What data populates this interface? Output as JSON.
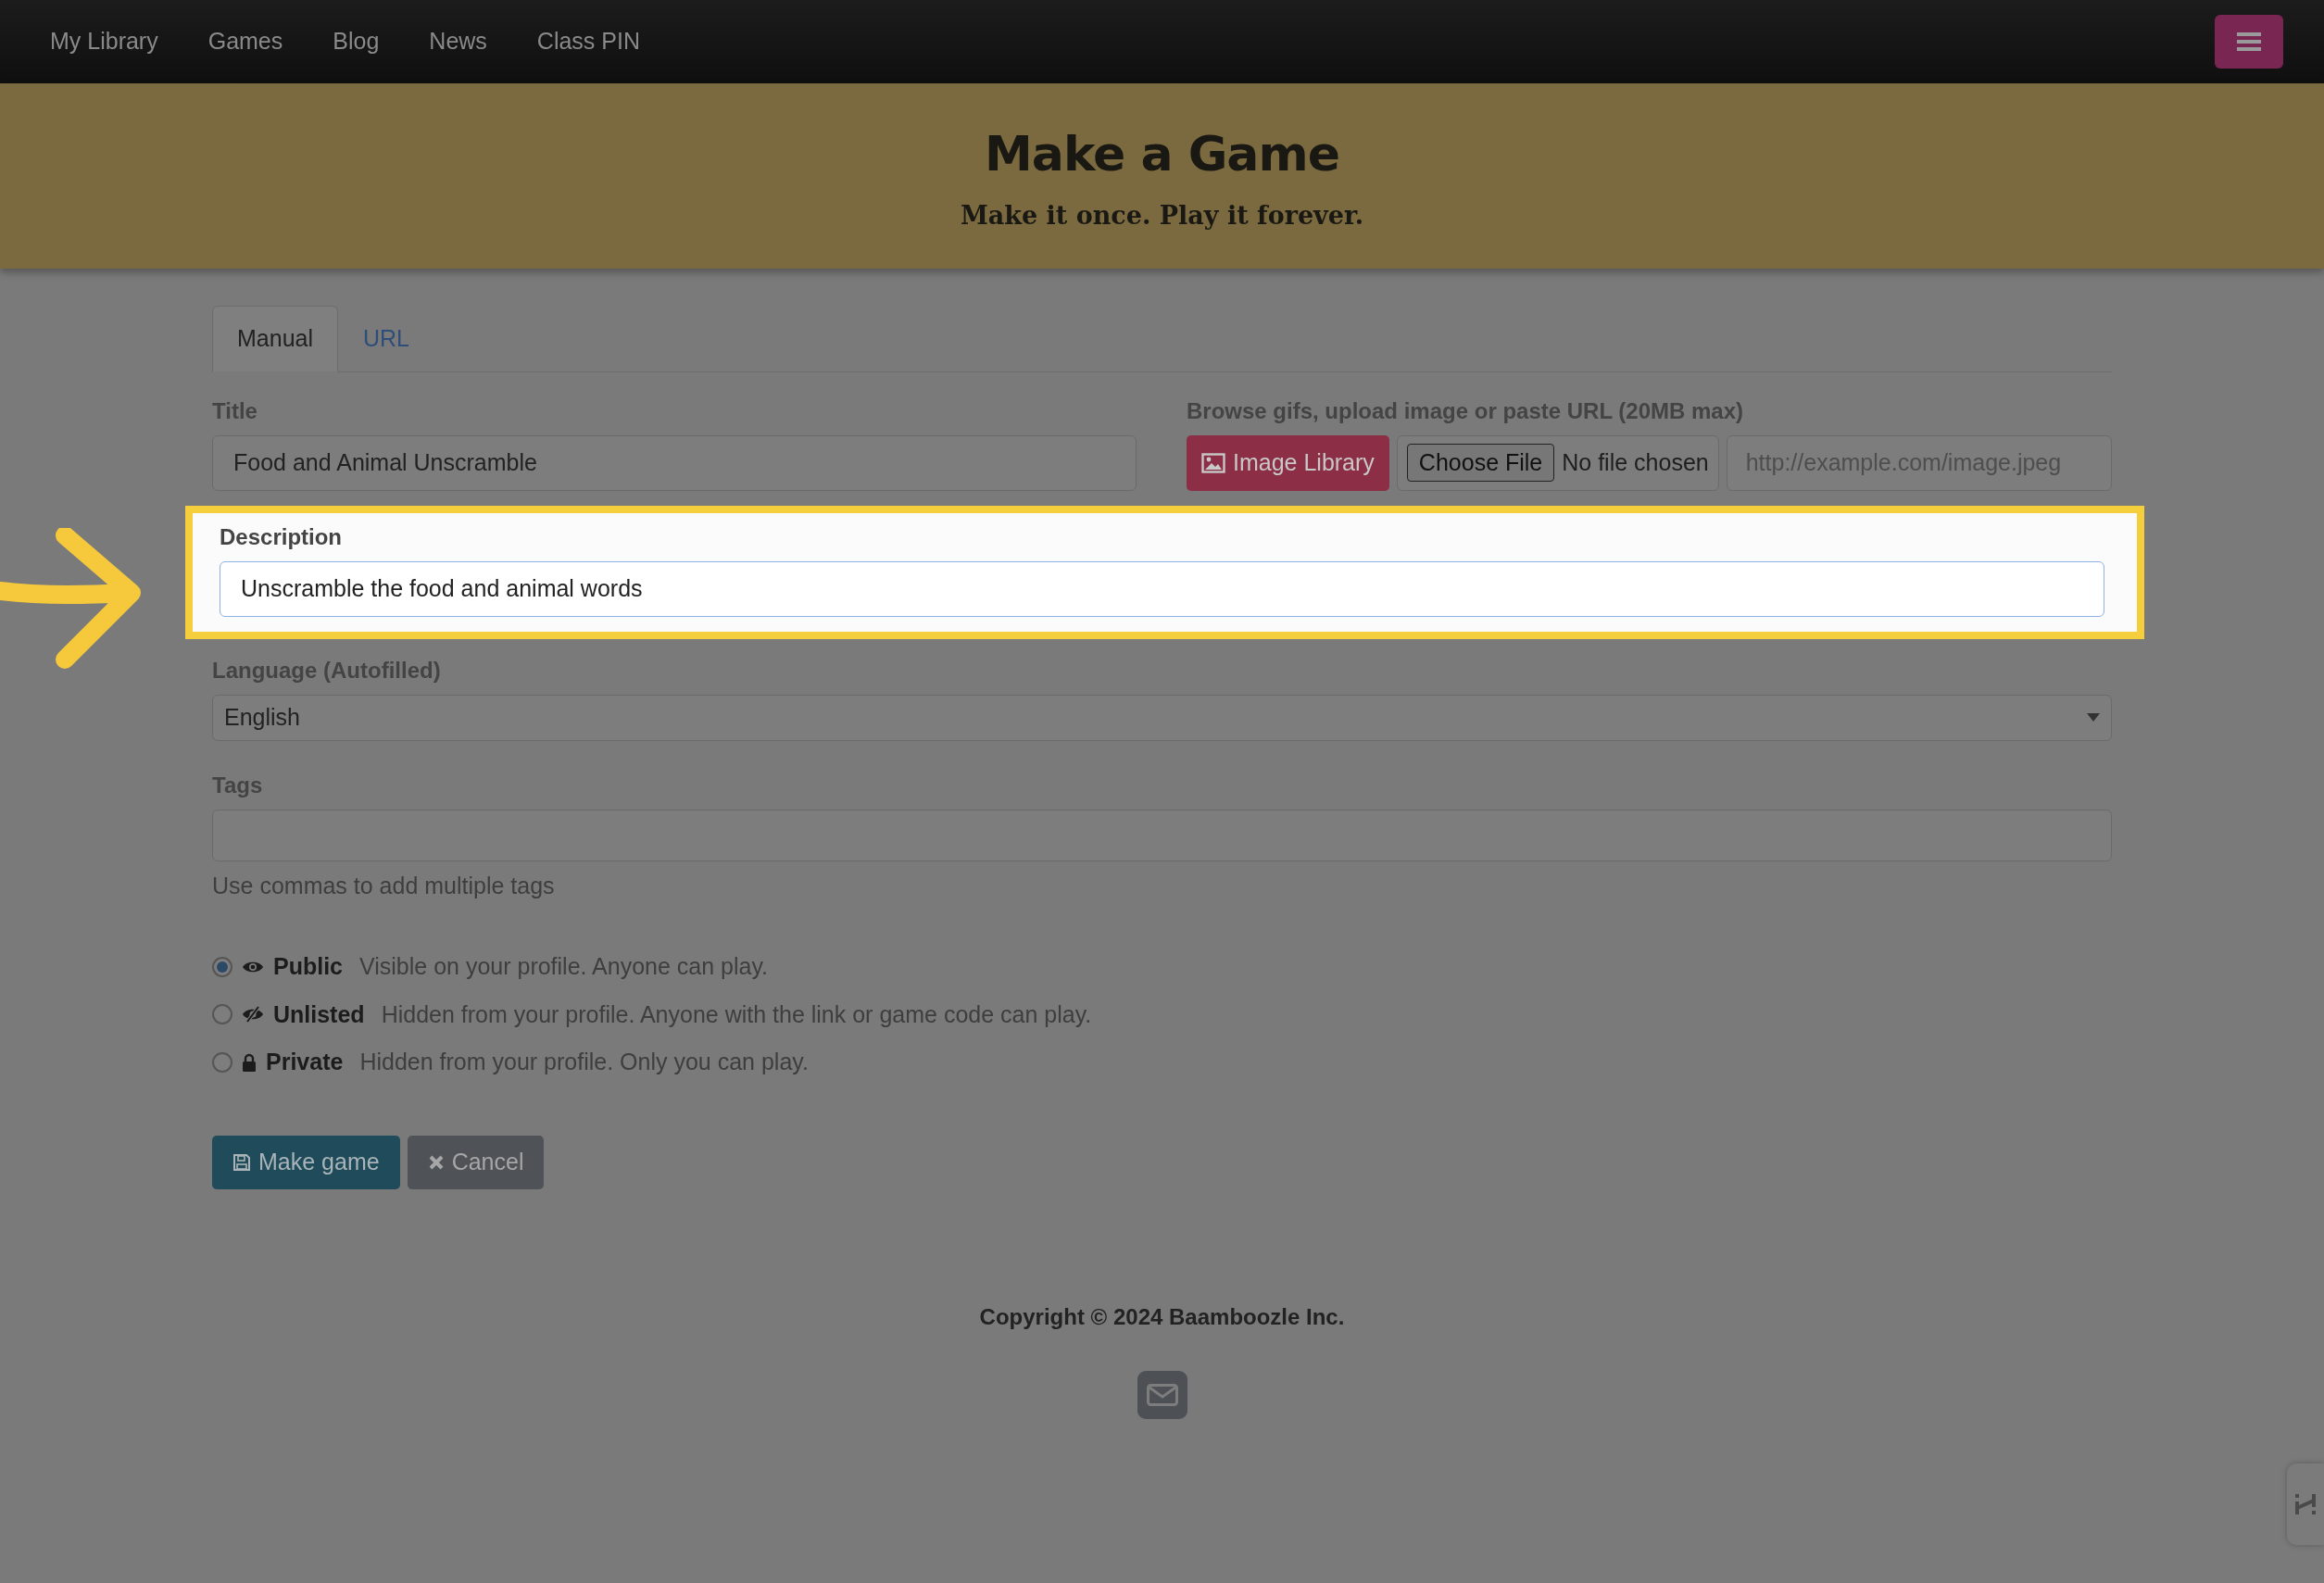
{
  "navbar": {
    "links": [
      "My Library",
      "Games",
      "Blog",
      "News",
      "Class PIN"
    ]
  },
  "header": {
    "title": "Make a Game",
    "subtitle": "Make it once. Play it forever."
  },
  "tabs": [
    {
      "label": "Manual",
      "selected": true
    },
    {
      "label": "URL",
      "selected": false
    }
  ],
  "form": {
    "title": {
      "label": "Title",
      "value": "Food and Animal Unscramble"
    },
    "image": {
      "label": "Browse gifs, upload image or paste URL (20MB max)",
      "library_button": "Image Library",
      "file_button": "Choose File",
      "file_status": "No file chosen",
      "url_placeholder": "http://example.com/image.jpeg"
    },
    "description": {
      "label": "Description",
      "value": "Unscramble the food and animal words",
      "highlighted": true
    },
    "language": {
      "label": "Language (Autofilled)",
      "value": "English"
    },
    "tags": {
      "label": "Tags",
      "help": "Use commas to add multiple tags"
    },
    "visibility": [
      {
        "kind": "eye",
        "label": "Public",
        "description": "Visible on your profile. Anyone can play.",
        "selected": true
      },
      {
        "kind": "eye-slash",
        "label": "Unlisted",
        "description": "Hidden from your profile. Anyone with the link or game code can play.",
        "selected": false
      },
      {
        "kind": "lock",
        "label": "Private",
        "description": "Hidden from your profile. Only you can play.",
        "selected": false
      }
    ]
  },
  "buttons": [
    {
      "kind": "save",
      "label": "Make game"
    },
    {
      "kind": "cancel",
      "label": "Cancel"
    }
  ],
  "footer": {
    "copyright": "Copyright © 2024 Baamboozle Inc."
  }
}
